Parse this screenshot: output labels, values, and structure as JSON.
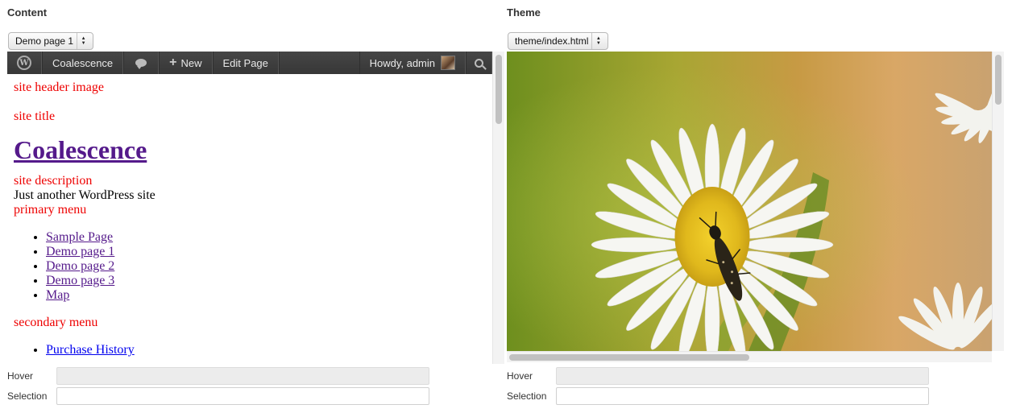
{
  "content_panel": {
    "title": "Content",
    "page_select": "Demo page 1",
    "admin_bar": {
      "site_name": "Coalescence",
      "new_label": "New",
      "edit_label": "Edit Page",
      "howdy": "Howdy, admin"
    },
    "body": {
      "header_image_label": "site header image",
      "site_title_label": "site title",
      "site_title": "Coalescence",
      "site_description_label": "site description",
      "site_description": "Just another WordPress site",
      "primary_menu_label": "primary menu",
      "primary_menu_items": [
        "Sample Page",
        "Demo page 1",
        "Demo page 2",
        "Demo page 3",
        "Map"
      ],
      "secondary_menu_label": "secondary menu",
      "secondary_menu_items": [
        "Purchase History"
      ]
    },
    "hover_label": "Hover",
    "hover_value": "",
    "selection_label": "Selection",
    "selection_value": ""
  },
  "theme_panel": {
    "title": "Theme",
    "file_select": "theme/index.html",
    "hover_label": "Hover",
    "hover_value": "",
    "selection_label": "Selection",
    "selection_value": ""
  },
  "icons": {
    "wp_logo": "wordpress-logo-icon",
    "comments": "comment-bubble-icon",
    "new": "plus-icon",
    "search": "search-icon",
    "select_arrows": "up-down-arrows-icon"
  },
  "colors": {
    "admin_bar": "#464646",
    "label_red": "#ee0000",
    "visited_link": "#551a8b"
  }
}
